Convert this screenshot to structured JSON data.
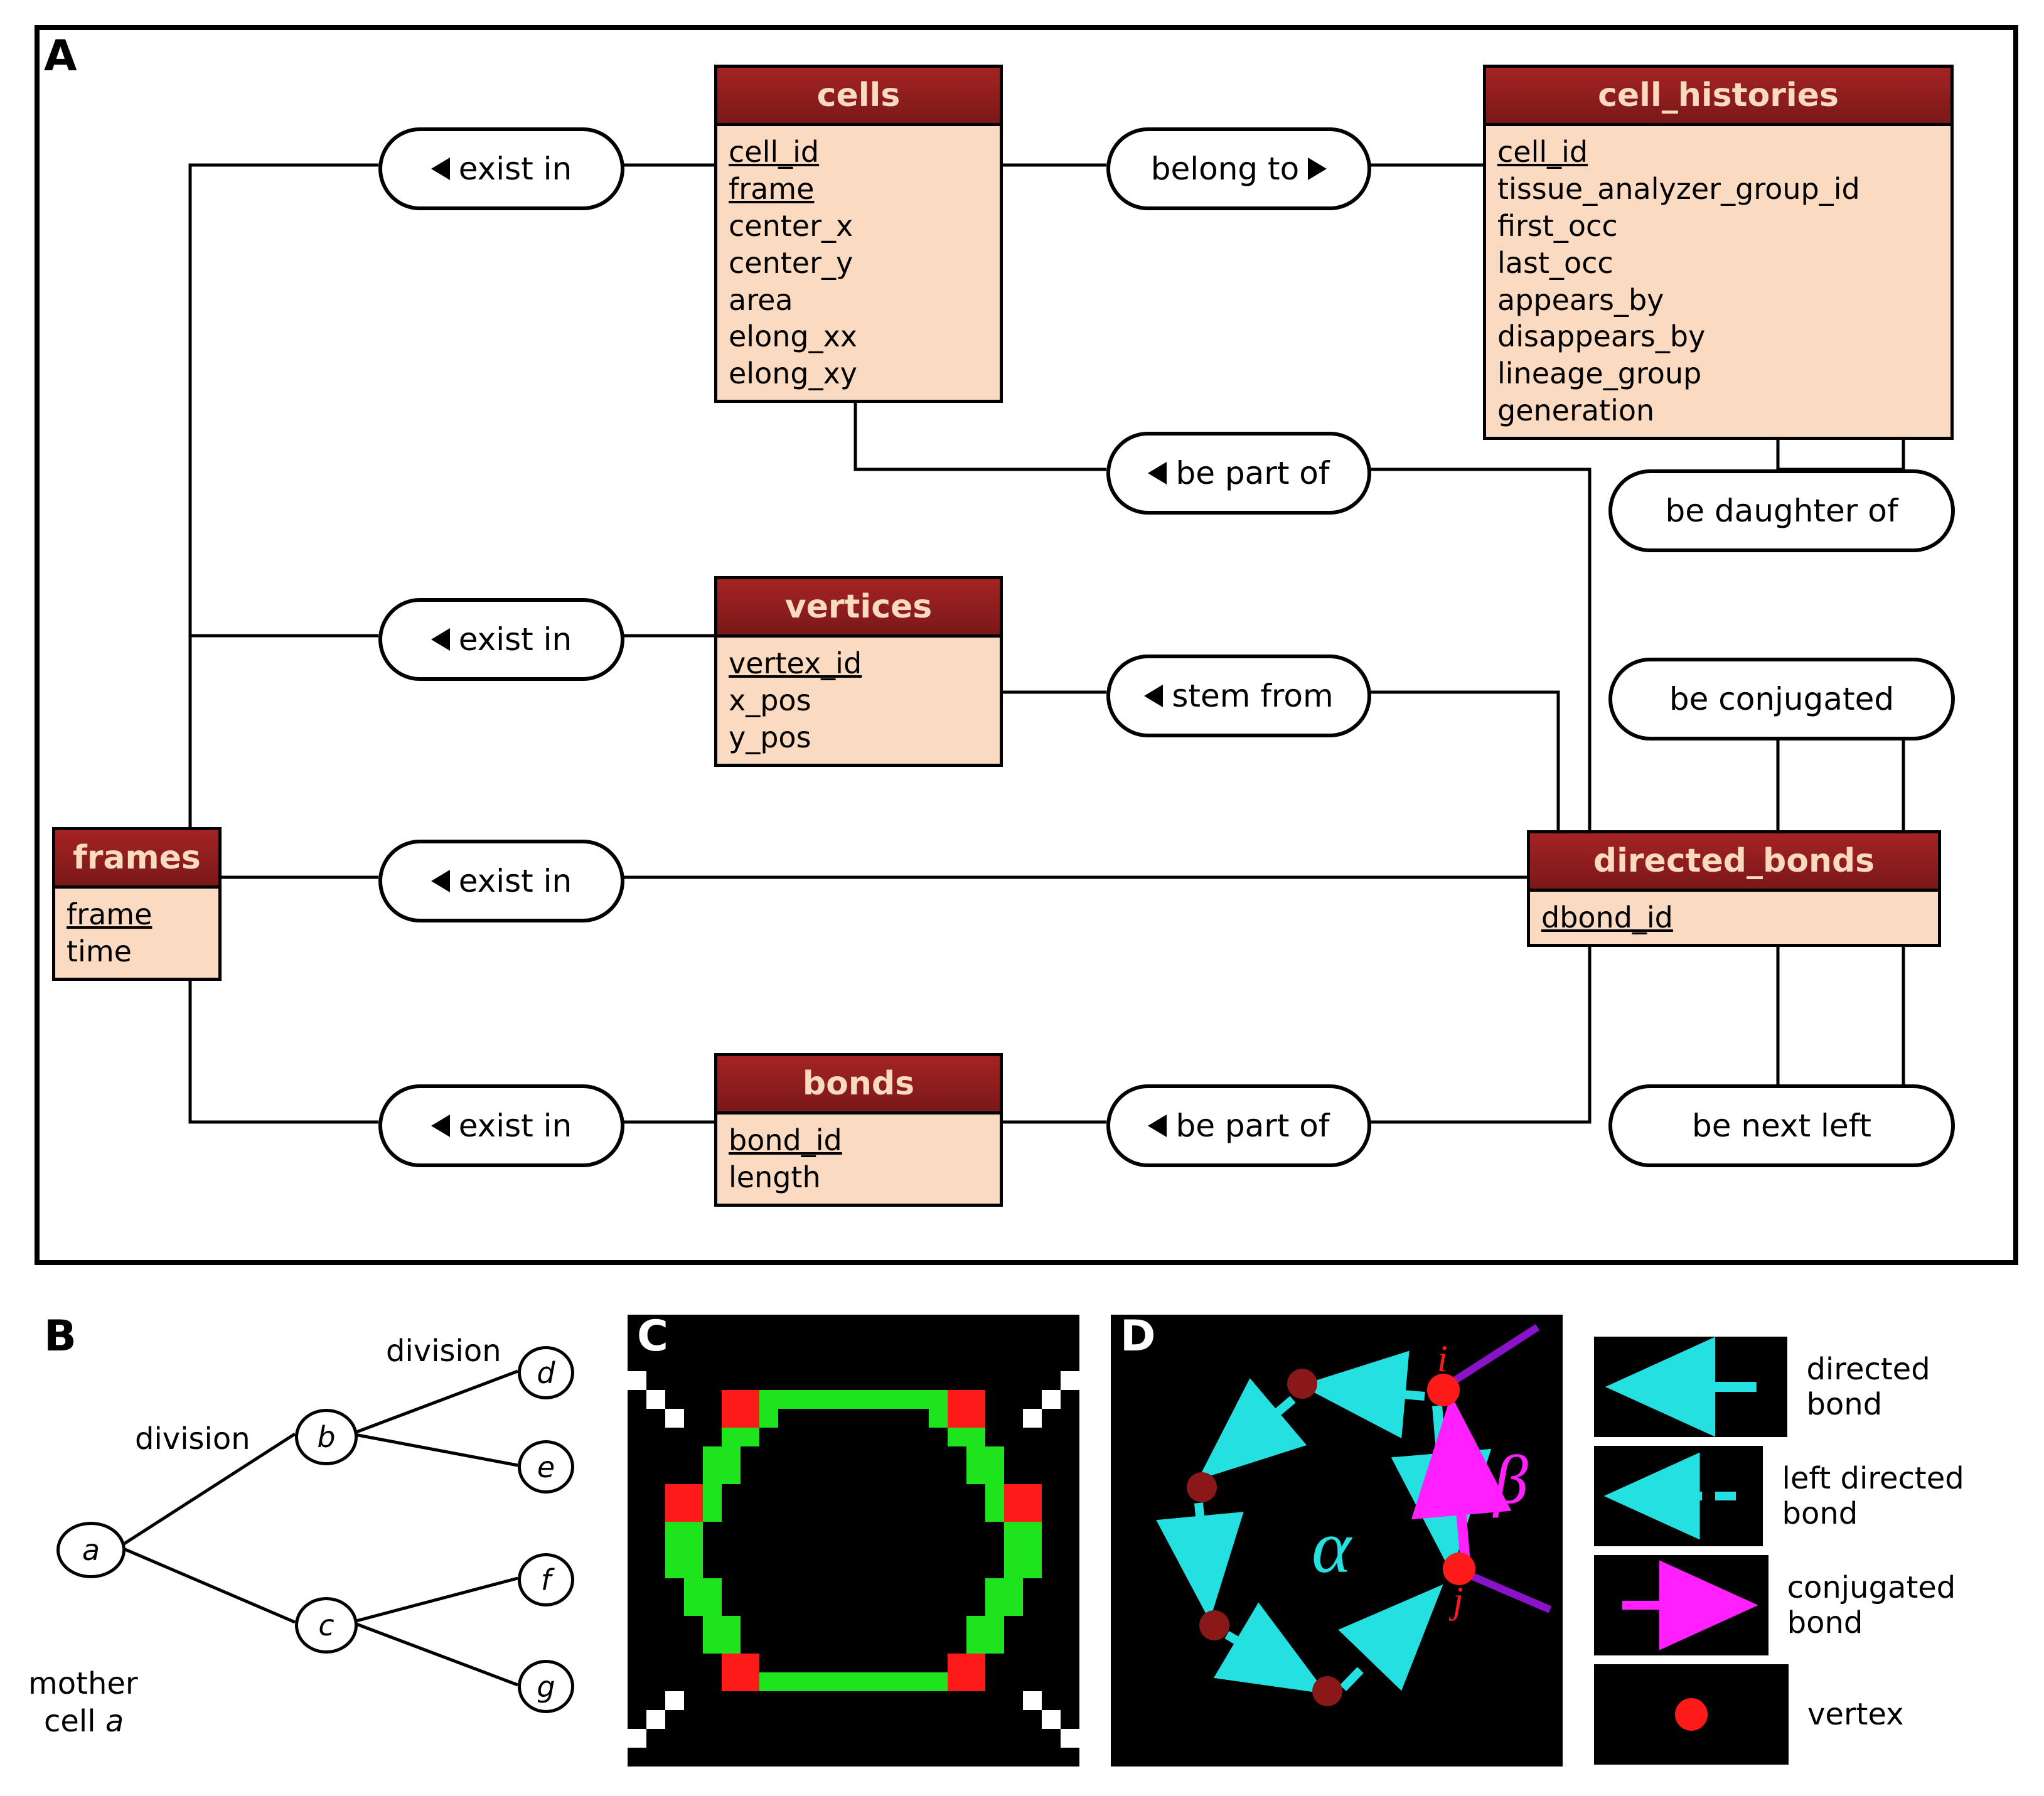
{
  "panelA": {
    "label": "A",
    "tables": {
      "frames": {
        "title": "frames",
        "fields": [
          {
            "n": "frame",
            "pk": true
          },
          {
            "n": "time"
          }
        ]
      },
      "cells": {
        "title": "cells",
        "fields": [
          {
            "n": "cell_id",
            "pk": true
          },
          {
            "n": "frame",
            "pk": true
          },
          {
            "n": "center_x"
          },
          {
            "n": "center_y"
          },
          {
            "n": "area"
          },
          {
            "n": "elong_xx"
          },
          {
            "n": "elong_xy"
          }
        ]
      },
      "cell_histories": {
        "title": "cell_histories",
        "fields": [
          {
            "n": "cell_id",
            "pk": true
          },
          {
            "n": "tissue_analyzer_group_id"
          },
          {
            "n": "first_occ"
          },
          {
            "n": "last_occ"
          },
          {
            "n": "appears_by"
          },
          {
            "n": "disappears_by"
          },
          {
            "n": "lineage_group"
          },
          {
            "n": "generation"
          }
        ]
      },
      "vertices": {
        "title": "vertices",
        "fields": [
          {
            "n": "vertex_id",
            "pk": true
          },
          {
            "n": "x_pos"
          },
          {
            "n": "y_pos"
          }
        ]
      },
      "directed_bonds": {
        "title": "directed_bonds",
        "fields": [
          {
            "n": "dbond_id",
            "pk": true
          }
        ]
      },
      "bonds": {
        "title": "bonds",
        "fields": [
          {
            "n": "bond_id",
            "pk": true
          },
          {
            "n": "length"
          }
        ]
      }
    },
    "rels": {
      "exist1": "exist in",
      "exist2": "exist in",
      "exist3": "exist in",
      "exist4": "exist in",
      "belong": "belong to",
      "bepart1": "be part of",
      "stem": "stem from",
      "bedaughter": "be daughter of",
      "beconj": "be conjugated",
      "bepart2": "be part of",
      "benext": "be next left"
    }
  },
  "panelB": {
    "label": "B",
    "division": "division",
    "mother_line1": "mother",
    "mother_line2": "cell a",
    "nodes": {
      "a": "a",
      "b": "b",
      "c": "c",
      "d": "d",
      "e": "e",
      "f": "f",
      "g": "g"
    }
  },
  "panelC": {
    "label": "C"
  },
  "panelD": {
    "label": "D",
    "alpha": "α",
    "beta": "β",
    "i": "i",
    "j": "j"
  },
  "legend": {
    "directed": "directed bond",
    "left": "left directed bond",
    "conj": "conjugated bond",
    "vertex": "vertex"
  },
  "colors": {
    "header_top": "#a52323",
    "header_bot": "#7a1818",
    "header_text": "#fadac0",
    "body_bg": "#fadac0",
    "cyan": "#24e0e0",
    "magenta": "#ff1fff",
    "green": "#1ee41e",
    "red": "#ff1a1a",
    "darkred": "#8a1818",
    "purple": "#8a12c8"
  }
}
